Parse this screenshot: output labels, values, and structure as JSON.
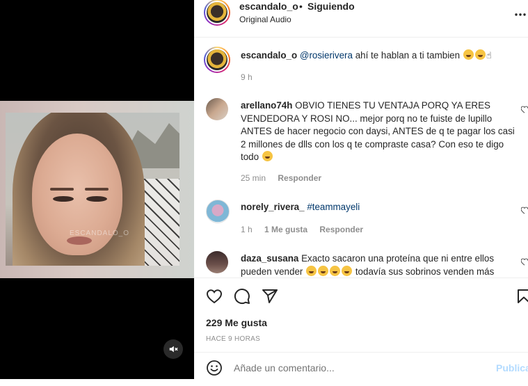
{
  "post": {
    "author": "escandalo_o",
    "separator": "•",
    "follow_status": "Siguiendo",
    "audio": "Original Audio",
    "more_icon": "more-horizontal-icon",
    "video_watermark": "ESCANDALO_O"
  },
  "caption": {
    "username": "escandalo_o",
    "mention": "@rosierivera",
    "text": " ahí te hablan a ti tambien",
    "time": "9 h"
  },
  "comments": [
    {
      "username": "arellano74h",
      "text": "OBVIO TIENES TU VENTAJA PORQ YA ERES VENDEDORA Y ROSI NO... mejor porq no te fuiste de lupillo ANTES de hacer negocio con daysi, ANTES de q te pagar los casi 2 millones de dlls con los q te compraste casa? Con eso te digo todo",
      "time": "25 min",
      "reply": "Responder"
    },
    {
      "username": "norely_rivera_",
      "mention": "#teammayeli",
      "time": "1 h",
      "likes": "1 Me gusta",
      "reply": "Responder"
    },
    {
      "username": "daza_susana",
      "text": "Exacto sacaron una proteína que ni entre ellos pueden vender",
      "text2": "todavía sus sobrinos venden más"
    }
  ],
  "footer": {
    "likes": "229 Me gusta",
    "time_ago": "HACE 9 HORAS",
    "comment_placeholder": "Añade un comentario...",
    "publish": "Publica"
  },
  "colors": {
    "accent": "#0095f6",
    "publish_disabled": "#b3dbff",
    "mention": "#00376b",
    "secondary_text": "#8e8e8e"
  }
}
